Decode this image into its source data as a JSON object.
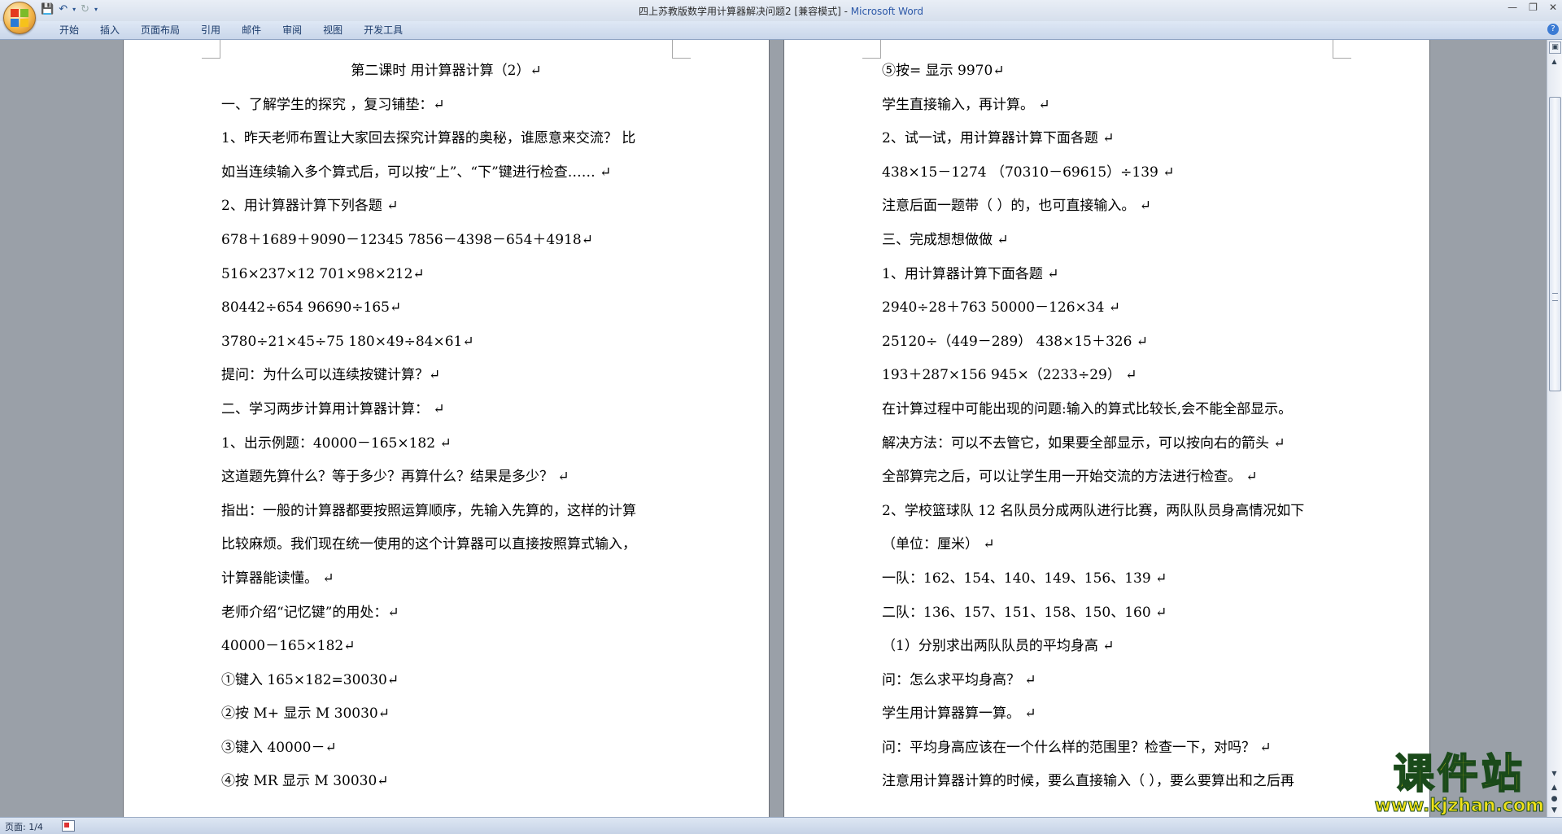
{
  "window": {
    "title": "四上苏教版数学用计算器解决问题2 [兼容模式] - ",
    "app_name": "Microsoft Word"
  },
  "quick_access": {
    "save_icon": "save-icon",
    "undo_icon": "undo-icon",
    "redo_icon": "redo-icon"
  },
  "ribbon": {
    "tabs": [
      "开始",
      "插入",
      "页面布局",
      "引用",
      "邮件",
      "审阅",
      "视图",
      "开发工具"
    ]
  },
  "document": {
    "left_page": {
      "lines": [
        "第二课时  用计算器计算（2）↵",
        "一、了解学生的探究 ，复习铺垫：↵",
        "1、昨天老师布置让大家回去探究计算器的奥秘，谁愿意来交流？  比",
        "如当连续输入多个算式后，可以按“上”、“下”键进行检查…… ↵",
        "2、用计算器计算下列各题                                          ↵",
        "678＋1689＋9090－12345       7856－4398－654＋4918↵",
        "516×237×12                      701×98×212↵",
        "80442÷654                        96690÷165↵",
        "3780÷21×45÷75                   180×49÷84×61↵",
        "提问：为什么可以连续按键计算？↵",
        "二、学习两步计算用计算器计算：  ↵",
        "1、出示例题：40000－165×182 ↵",
        "这道题先算什么？等于多少？再算什么？结果是多少？ ↵",
        "指出：一般的计算器都要按照运算顺序，先输入先算的，这样的计算",
        "比较麻烦。我们现在统一使用的这个计算器可以直接按照算式输入，",
        "计算器能读懂。 ↵",
        "老师介绍“记忆键”的用处：↵",
        "40000－165×182↵",
        "①键入 165×182=30030↵",
        "②按 M+   显示 M     30030↵",
        "③键入 40000－↵",
        "④按 MR   显示   M     30030↵"
      ]
    },
    "right_page": {
      "lines": [
        "⑤按=       显示 9970↵",
        "学生直接输入，再计算。 ↵",
        "2、试一试，用计算器计算下面各题 ↵",
        "438×15－1274            （70310－69615）÷139 ↵",
        "注意后面一题带（ ）的，也可直接输入。 ↵",
        "三、完成想想做做 ↵",
        "1、用计算器计算下面各题 ↵",
        "2940÷28＋763              50000－126×34 ↵",
        "25120÷（449－289）         438×15＋326 ↵",
        "193＋287×156               945×（2233÷29） ↵",
        "在计算过程中可能出现的问题:输入的算式比较长,会不能全部显示。",
        "解决方法：可以不去管它，如果要全部显示，可以按向右的箭头 ↵",
        "全部算完之后，可以让学生用一开始交流的方法进行检查。 ↵",
        "2、学校篮球队 12 名队员分成两队进行比赛，两队队员身高情况如下",
        "（单位：厘米） ↵",
        "一队：162、154、140、149、156、139 ↵",
        "二队：136、157、151、158、150、160 ↵",
        "（1）分别求出两队队员的平均身高 ↵",
        "问：怎么求平均身高？ ↵",
        "学生用计算器算一算。 ↵",
        "问：平均身高应该在一个什么样的范围里？检查一下，对吗？ ↵",
        "注意用计算器计算的时候，要么直接输入（ ），要么要算出和之后再"
      ]
    }
  },
  "status_bar": {
    "page_info": "页面: 1/4"
  },
  "watermark": {
    "main": "课件站",
    "url": "www.kjzhan.com",
    "color": "#f2e21a"
  }
}
